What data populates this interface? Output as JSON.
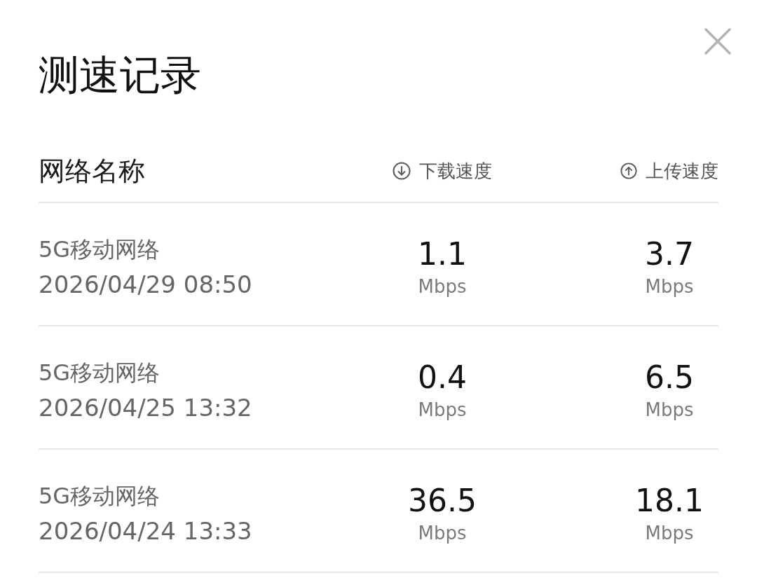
{
  "dialog": {
    "title": "测速记录"
  },
  "table": {
    "columns": [
      {
        "label": "网络名称",
        "kind": "name"
      },
      {
        "label": "下载速度",
        "kind": "download"
      },
      {
        "label": "上传速度",
        "kind": "upload"
      }
    ],
    "rows": [
      {
        "network": "5G移动网络",
        "time": "2026/04/29 08:50",
        "download": {
          "value": "1.1",
          "unit": "Mbps"
        },
        "upload": {
          "value": "3.7",
          "unit": "Mbps"
        }
      },
      {
        "network": "5G移动网络",
        "time": "2026/04/25 13:32",
        "download": {
          "value": "0.4",
          "unit": "Mbps"
        },
        "upload": {
          "value": "6.5",
          "unit": "Mbps"
        }
      },
      {
        "network": "5G移动网络",
        "time": "2026/04/24 13:33",
        "download": {
          "value": "36.5",
          "unit": "Mbps"
        },
        "upload": {
          "value": "18.1",
          "unit": "Mbps"
        }
      }
    ]
  }
}
